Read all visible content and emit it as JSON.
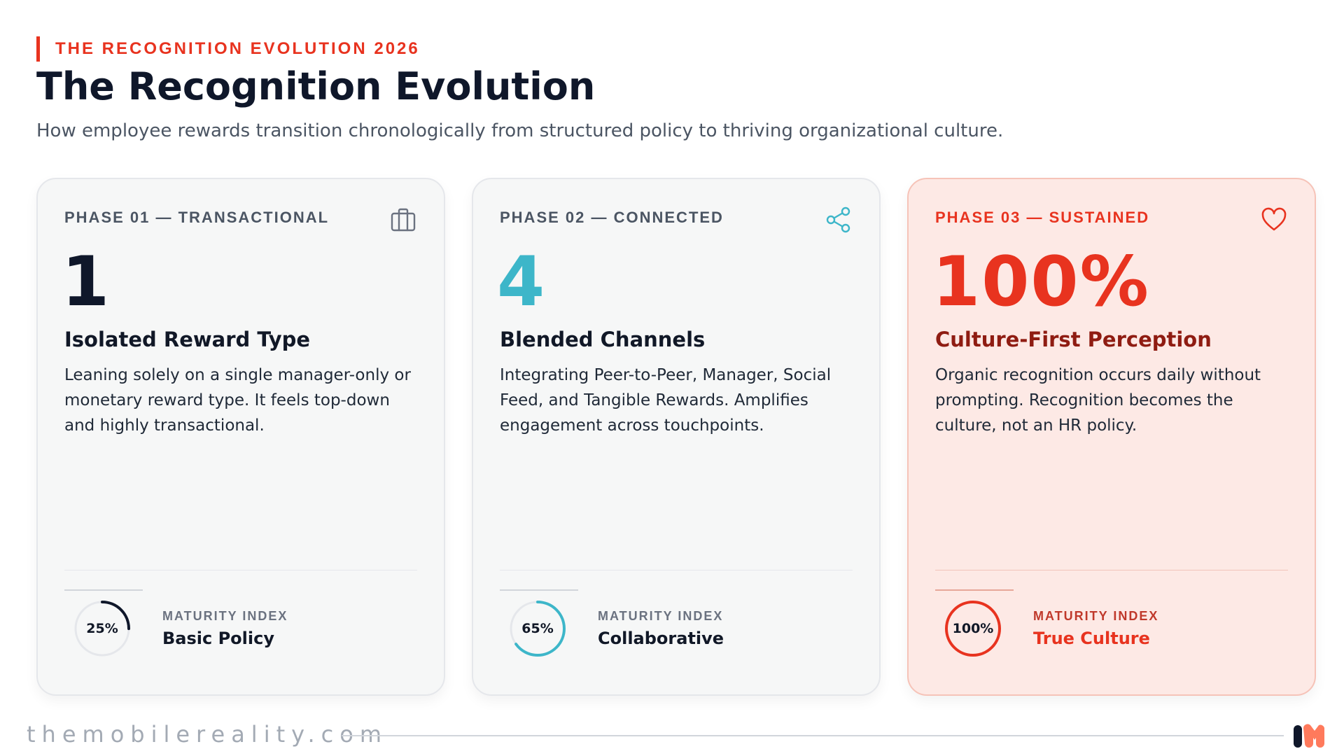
{
  "header": {
    "eyebrow": "THE RECOGNITION EVOLUTION 2026",
    "title": "The Recognition Evolution",
    "subtitle": "How employee rewards transition chronologically from structured policy to thriving organizational culture."
  },
  "cards": [
    {
      "phase": "PHASE 01 — TRANSACTIONAL",
      "icon": "briefcase-icon",
      "big": "1",
      "headline": "Isolated Reward Type",
      "description": "Leaning solely on a single manager-only or monetary reward type. It feels top-down and highly transactional.",
      "maturity_label": "MATURITY INDEX",
      "maturity_percent_text": "25%",
      "maturity_fraction": 0.25,
      "maturity_value": "Basic Policy",
      "accent": "#0f172a"
    },
    {
      "phase": "PHASE 02 — CONNECTED",
      "icon": "share-icon",
      "big": "4",
      "headline": "Blended Channels",
      "description": "Integrating Peer-to-Peer, Manager, Social Feed, and Tangible Rewards. Amplifies engagement across touchpoints.",
      "maturity_label": "MATURITY INDEX",
      "maturity_percent_text": "65%",
      "maturity_fraction": 0.65,
      "maturity_value": "Collaborative",
      "accent": "#3db6c9"
    },
    {
      "phase": "PHASE 03 — SUSTAINED",
      "icon": "heart-icon",
      "big": "100%",
      "headline": "Culture-First Perception",
      "description": "Organic recognition occurs daily without prompting. Recognition becomes the culture, not an HR policy.",
      "maturity_label": "MATURITY INDEX",
      "maturity_percent_text": "100%",
      "maturity_fraction": 1.0,
      "maturity_value": "True Culture",
      "accent": "#e8331f"
    }
  ],
  "footer": {
    "site": "themobilereality.com",
    "logo": "mobile-reality-logo"
  },
  "colors": {
    "brand_red": "#e8331f",
    "teal": "#3db6c9",
    "navy": "#0f172a"
  }
}
